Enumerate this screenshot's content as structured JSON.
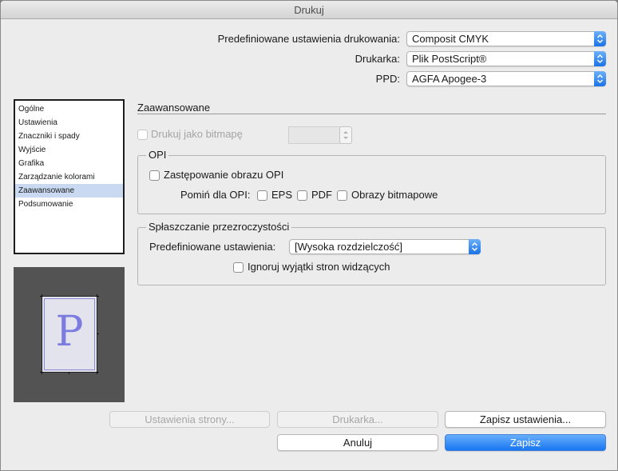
{
  "window": {
    "title": "Drukuj"
  },
  "header": {
    "preset_label": "Predefiniowane ustawienia drukowania:",
    "preset_value": "Composit CMYK",
    "printer_label": "Drukarka:",
    "printer_value": "Plik PostScript®",
    "ppd_label": "PPD:",
    "ppd_value": "AGFA Apogee-3"
  },
  "sidebar": {
    "items": [
      {
        "label": "Ogólne",
        "selected": false
      },
      {
        "label": "Ustawienia",
        "selected": false
      },
      {
        "label": "Znaczniki i spady",
        "selected": false
      },
      {
        "label": "Wyjście",
        "selected": false
      },
      {
        "label": "Grafika",
        "selected": false
      },
      {
        "label": "Zarządzanie kolorami",
        "selected": false
      },
      {
        "label": "Zaawansowane",
        "selected": true
      },
      {
        "label": "Podsumowanie",
        "selected": false
      }
    ]
  },
  "preview": {
    "letter": "P"
  },
  "main": {
    "title": "Zaawansowane",
    "print_as_bitmap": {
      "label": "Drukuj jako bitmapę",
      "checked": false,
      "disabled": true,
      "value": ""
    },
    "opi": {
      "legend": "OPI",
      "replace_label": "Zastępowanie obrazu OPI",
      "replace_checked": false,
      "omit_label": "Pomiń dla OPI:",
      "eps_label": "EPS",
      "eps_checked": false,
      "pdf_label": "PDF",
      "pdf_checked": false,
      "bitmap_label": "Obrazy bitmapowe",
      "bitmap_checked": false
    },
    "flattening": {
      "legend": "Spłaszczanie przezroczystości",
      "preset_label": "Predefiniowane ustawienia:",
      "preset_value": "[Wysoka rozdzielczość]",
      "ignore_label": "Ignoruj wyjątki stron widzących",
      "ignore_checked": false
    }
  },
  "buttons": {
    "page_setup": "Ustawienia strony...",
    "printer": "Drukarka...",
    "save_settings": "Zapisz ustawienia...",
    "cancel": "Anuluj",
    "save": "Zapisz"
  },
  "colors": {
    "accent": "#1b73e8",
    "selection": "#c9d9f2",
    "preview_letter": "#7b7be0"
  }
}
